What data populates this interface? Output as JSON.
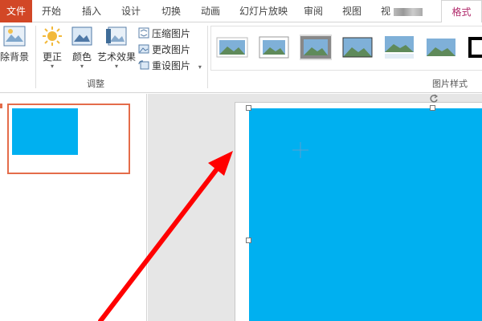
{
  "tabs": {
    "file": "文件",
    "home": "开始",
    "insert": "插入",
    "design": "设计",
    "transitions": "切换",
    "animations": "动画",
    "slideshow": "幻灯片放映",
    "review": "审阅",
    "view": "视图",
    "obscured": "视",
    "format": "格式"
  },
  "ribbon": {
    "remove_background": "除背景",
    "corrections": "更正",
    "color": "颜色",
    "artistic_effects": "艺术效果",
    "compress": "压缩图片",
    "change_picture": "更改图片",
    "reset_picture": "重设图片",
    "adjust_group": "调整",
    "picture_styles_group": "图片样式",
    "dropdown_glyph": "▾"
  },
  "colors": {
    "accent": "#d24726",
    "format_tab": "#b0296a",
    "shape_fill": "#00b0f0",
    "arrow": "#ff0000"
  }
}
